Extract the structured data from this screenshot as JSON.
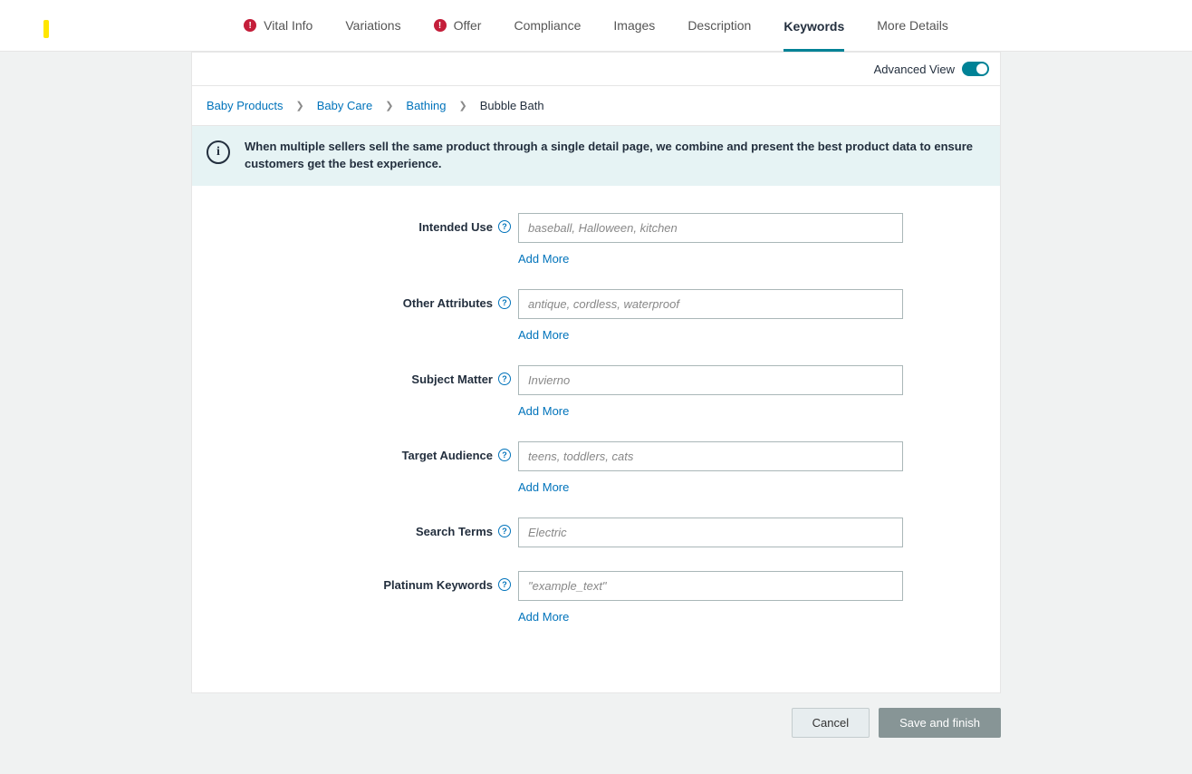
{
  "tabs": {
    "vital": "Vital Info",
    "variations": "Variations",
    "offer": "Offer",
    "compliance": "Compliance",
    "images": "Images",
    "description": "Description",
    "keywords": "Keywords",
    "more": "More Details"
  },
  "advancedView": {
    "label": "Advanced View"
  },
  "breadcrumb": {
    "i0": "Baby Products",
    "i1": "Baby Care",
    "i2": "Bathing",
    "i3": "Bubble Bath"
  },
  "banner": {
    "text": "When multiple sellers sell the same product through a single detail page, we combine and present the best product data to ensure customers get the best experience."
  },
  "fields": {
    "intendedUse": {
      "label": "Intended Use",
      "placeholder": "baseball, Halloween, kitchen",
      "addMore": "Add More"
    },
    "otherAttributes": {
      "label": "Other Attributes",
      "placeholder": "antique, cordless, waterproof",
      "addMore": "Add More"
    },
    "subjectMatter": {
      "label": "Subject Matter",
      "placeholder": "Invierno",
      "addMore": "Add More"
    },
    "targetAudience": {
      "label": "Target Audience",
      "placeholder": "teens, toddlers, cats",
      "addMore": "Add More"
    },
    "searchTerms": {
      "label": "Search Terms",
      "placeholder": "Electric"
    },
    "platinumKeywords": {
      "label": "Platinum Keywords",
      "placeholder": "\"example_text\"",
      "addMore": "Add More"
    }
  },
  "footer": {
    "cancel": "Cancel",
    "save": "Save and finish"
  }
}
